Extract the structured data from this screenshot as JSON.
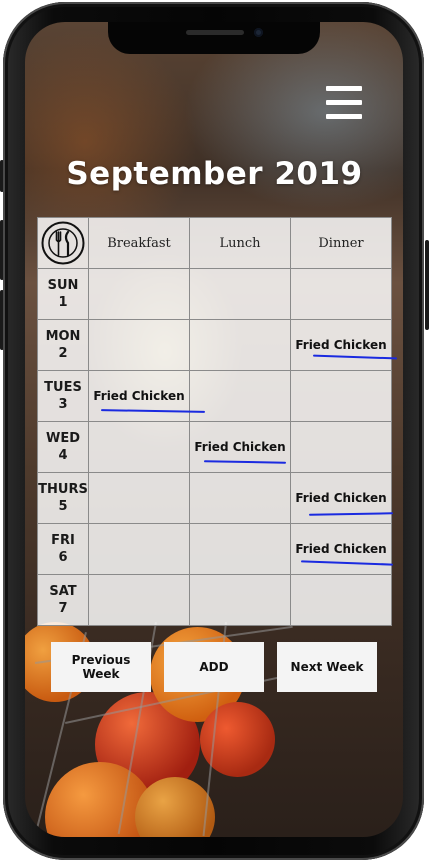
{
  "header": {
    "title": "September 2019"
  },
  "icons": {
    "menu": "hamburger-menu-icon",
    "logo": "fork-knife-plate-icon"
  },
  "schedule": {
    "columns": [
      "Breakfast",
      "Lunch",
      "Dinner"
    ],
    "days": [
      {
        "name": "SUN",
        "date": "1",
        "breakfast": "",
        "lunch": "",
        "dinner": ""
      },
      {
        "name": "MON",
        "date": "2",
        "breakfast": "",
        "lunch": "",
        "dinner": "Fried Chicken"
      },
      {
        "name": "TUES",
        "date": "3",
        "breakfast": "Fried Chicken",
        "lunch": "",
        "dinner": ""
      },
      {
        "name": "WED",
        "date": "4",
        "breakfast": "",
        "lunch": "Fried Chicken",
        "dinner": ""
      },
      {
        "name": "THURS",
        "date": "5",
        "breakfast": "",
        "lunch": "",
        "dinner": "Fried Chicken"
      },
      {
        "name": "FRI",
        "date": "6",
        "breakfast": "",
        "lunch": "",
        "dinner": "Fried Chicken"
      },
      {
        "name": "SAT",
        "date": "7",
        "breakfast": "",
        "lunch": "",
        "dinner": ""
      }
    ]
  },
  "actions": {
    "previous_week": "Previous Week",
    "add": "ADD",
    "next_week": "Next Week"
  },
  "colors": {
    "underline": "#1a2ae0",
    "title": "#ffffff"
  }
}
